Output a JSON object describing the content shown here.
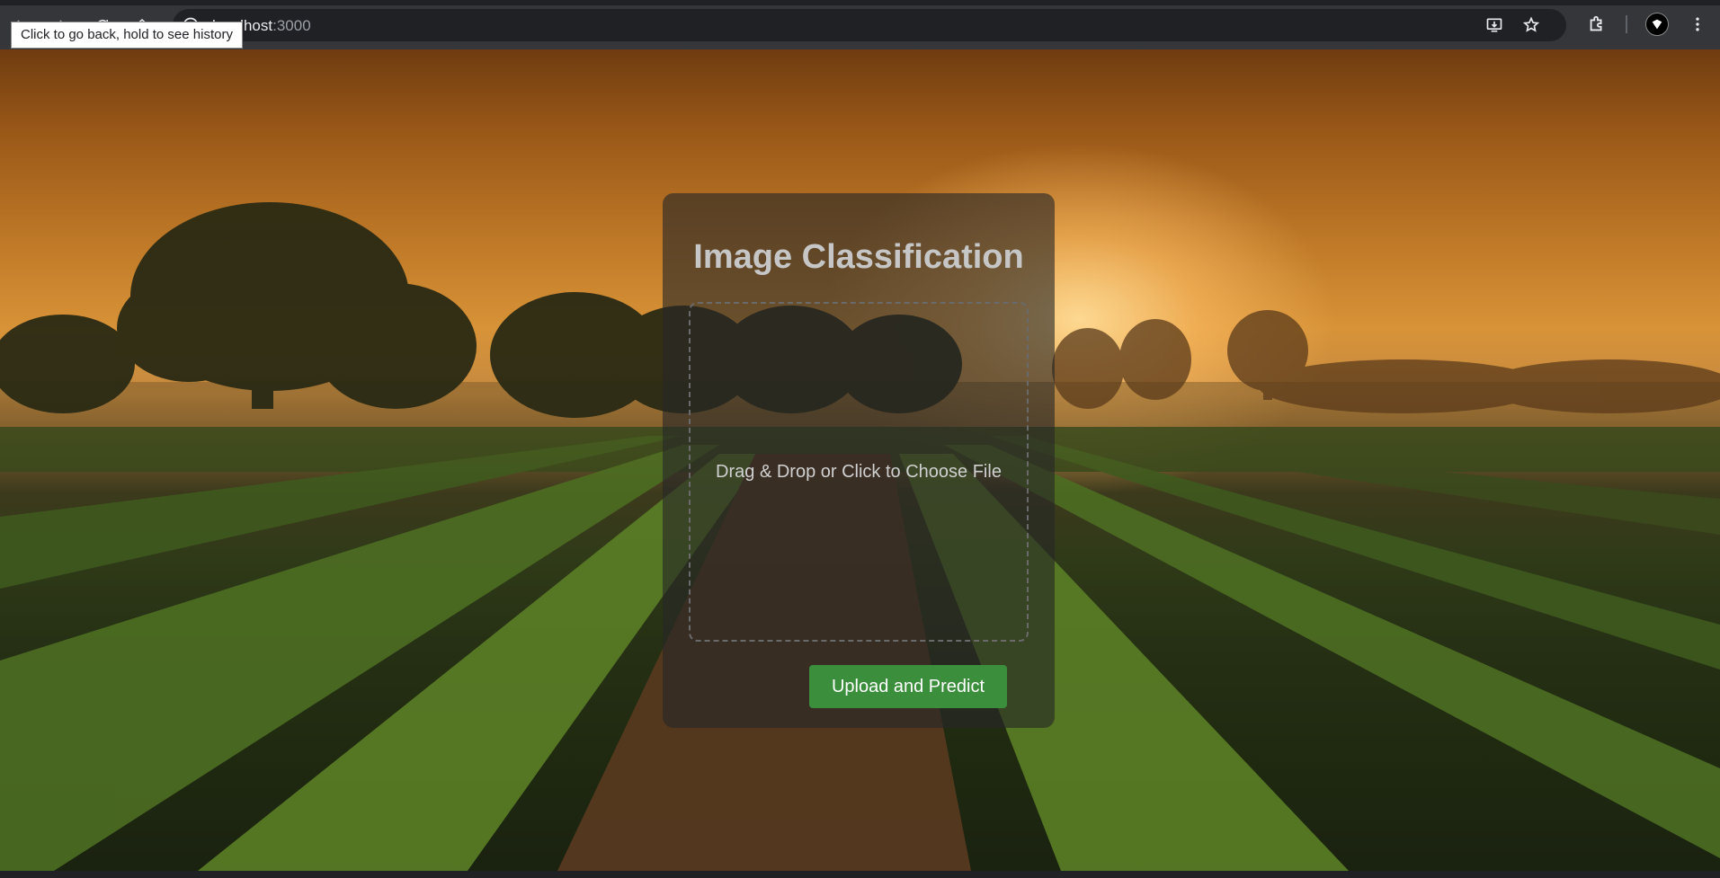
{
  "browser": {
    "url_host": "localhost",
    "url_port": ":3000",
    "tooltip": "Click to go back, hold to see history"
  },
  "page": {
    "title": "Image Classification",
    "dropzone_text": "Drag & Drop or Click to Choose File",
    "upload_button_label": "Upload and Predict"
  },
  "colors": {
    "button": "#3b8f3c",
    "card": "rgba(38,38,38,0.62)"
  }
}
